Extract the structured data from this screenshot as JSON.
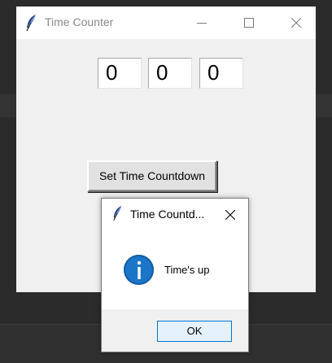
{
  "colors": {
    "desktop": "#2b2b2b",
    "window_bg": "#f0f0f0",
    "titlebar_bg": "#ffffff",
    "info_blue": "#1b76c9",
    "ok_border": "#0078d7"
  },
  "main_window": {
    "title": "Time Counter",
    "icon": "feather-icon",
    "controls": {
      "minimize": "minimize-icon",
      "maximize": "maximize-icon",
      "close": "close-icon"
    },
    "fields": {
      "hours": "0",
      "minutes": "0",
      "seconds": "0"
    },
    "set_button_label": "Set Time Countdown"
  },
  "dialog": {
    "title": "Time Countd...",
    "icon": "feather-icon",
    "close": "close-icon",
    "message_icon": "info-icon",
    "message": "Time's up",
    "ok_label": "OK"
  }
}
